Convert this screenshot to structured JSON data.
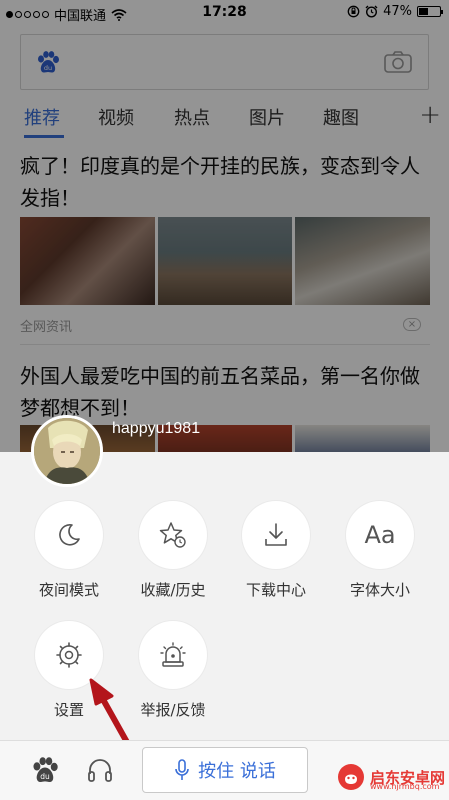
{
  "status_bar": {
    "carrier": "中国联通",
    "time": "17:28",
    "battery": "47%",
    "battery_level": 0.47
  },
  "tabs": [
    {
      "label": "推荐",
      "active": true
    },
    {
      "label": "视频",
      "active": false
    },
    {
      "label": "热点",
      "active": false
    },
    {
      "label": "图片",
      "active": false
    },
    {
      "label": "趣图",
      "active": false
    }
  ],
  "tabs_plus": "+",
  "feed": [
    {
      "title": "疯了！印度真的是个开挂的民族，变态到令人发指！",
      "source": "全网资讯"
    },
    {
      "title": "外国人最爱吃中国的前五名菜品，第一名你做梦都想不到！"
    }
  ],
  "dismiss_glyph": "×",
  "user": {
    "name": "happyu1981"
  },
  "menu": [
    {
      "label": "夜间模式",
      "icon": "moon-icon"
    },
    {
      "label": "收藏/历史",
      "icon": "star-history-icon"
    },
    {
      "label": "下载中心",
      "icon": "download-icon"
    },
    {
      "label": "字体大小",
      "icon": "font-size-icon",
      "glyph": "Aa"
    },
    {
      "label": "设置",
      "icon": "settings-gear-icon"
    },
    {
      "label": "举报/反馈",
      "icon": "siren-icon"
    }
  ],
  "bottom_bar": {
    "talk_button": "按住 说话"
  },
  "watermark": {
    "text": "启东安卓网",
    "sub": "www.hjrmbq.com"
  },
  "colors": {
    "accent": "#3a6fd8",
    "arrow": "#b3151b",
    "watermark": "#e53935"
  }
}
